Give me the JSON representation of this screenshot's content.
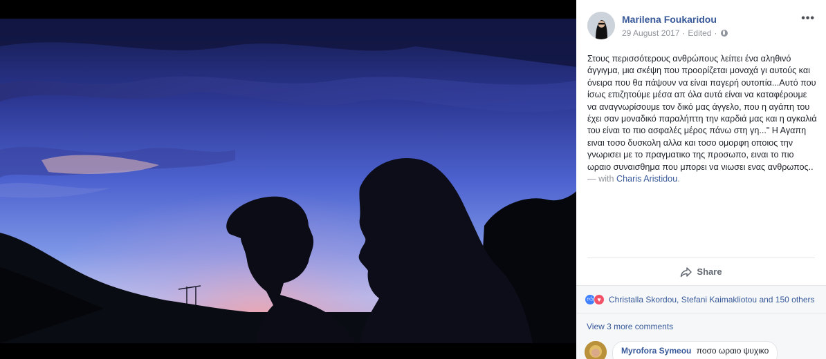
{
  "post": {
    "author": "Marilena Foukaridou",
    "date": "29 August 2017",
    "separator": "·",
    "edited": "Edited",
    "dot": "·",
    "more": "•••",
    "text": "Στους περισσότερους ανθρώπους λείπει ένα αληθινό άγγιγμα, μια σκέψη που προορίζεται μοναχά γι αυτούς και όνειρα που θα πάψουν να είναι παγερή ουτοπία...Αυτό που ίσως επιζητούμε μέσα απ όλα αυτά είναι να καταφέρουμε να αναγνωρίσουμε τον δικό μας άγγελο, που η αγάπη του έχει σαν μοναδικό παραλήπτη την καρδιά μας και η αγκαλιά του είναι το πιο ασφαλές μέρος πάνω στη γη...\" Η Αγαπη ειναι τοσο δυσκολη αλλα και τοσο ομορφη οποιος την γνωρισει με το πραγματικο της προσωπο, ειναι το πιο ωραιο συναισθημα που μπορει να νιωσει ενας ανθρωπος..",
    "with_label": " — with ",
    "tagged": "Charis Aristidou",
    "tagged_end": "."
  },
  "actions": {
    "share_label": "Share"
  },
  "reactions": {
    "like_icon": "like-icon",
    "love_icon": "love-icon",
    "summary": "Christalla Skordou, Stefani Kaimakliotou and 150 others"
  },
  "comments": {
    "view_more": "View 3 more comments",
    "items": [
      {
        "author": "Myrofora Symeou",
        "text": "ποσο ωραιο ψυχικο"
      }
    ]
  },
  "colors": {
    "link": "#365899",
    "meta": "#90949c",
    "text": "#1d2129",
    "sky_top": "#1b1f5e",
    "sky_mid": "#5b6fd6",
    "sky_low": "#b9c7f2",
    "sunset": "#e8a0a8"
  }
}
